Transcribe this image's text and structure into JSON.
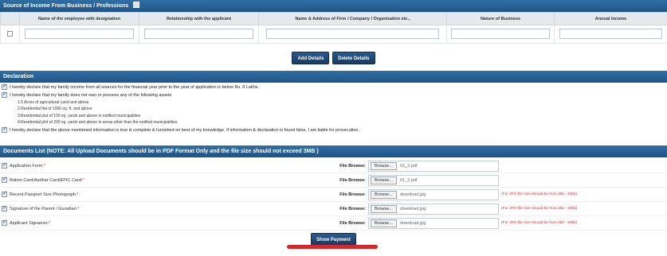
{
  "income_section": {
    "title": "Source of Income From Business / Professions",
    "columns": [
      "Name of the employee with designation",
      "Relationship with the applicant",
      "Name & Address of Firm / Company / Organization etc.,",
      "Nature of Business",
      "Annual Income"
    ],
    "add_button": "Add Details",
    "delete_button": "Delete Details"
  },
  "declaration": {
    "title": "Declaration",
    "line1": "I hereby declare that my family income from all sources for the financial year prior to the year of application is below Rs. 8 Lakhs.",
    "line2": "I hereby declare that my family does not own or possess any of the following assets",
    "assets": [
      "1.5 Acres of agricultural Land and above",
      "2.Residential flat of 1000 sq. ft. and above",
      "3.Residential plot of 100 sq. yards and above in notified municipalities",
      "4.Residential plot of 200 sq. yards and above in areas other than the notified municipalities"
    ],
    "line3": "I hereby declare that the above mentioned information is true & complete & furnished on best of my knowledge. If information & declaration is found false, I am liable for prosecution."
  },
  "documents": {
    "title": "Documents List (NOTE: All Upload Documents should be in PDF Format Only and the file size should not exceed 3MB )",
    "file_browse_label": "File Browse:",
    "browse_label": "Browse...",
    "rows": [
      {
        "label": "Application Form:",
        "file": "01_2.pdf",
        "note": ""
      },
      {
        "label": "Ration Card/Aadhar Card/EPIC Card:",
        "file": "01_2.pdf",
        "note": ""
      },
      {
        "label": "Recent Passport Size Photograph:",
        "file": "download.jpg",
        "note": "(For JPG file size should be from 3kb - 20kb)"
      },
      {
        "label": "Signature of the Parent / Guradian:",
        "file": "download.jpg",
        "note": "(For JPG file size should be from 3kb - 20kb)"
      },
      {
        "label": "Applicant Signature:",
        "file": "download.jpg",
        "note": "(For JPG file size should be from 3kb - 20kb)"
      }
    ]
  },
  "show_payment_button": "Show Payment",
  "colors": {
    "section_bar": "#1f5486",
    "button": "#173a63",
    "highlight_underline": "#d62828"
  }
}
